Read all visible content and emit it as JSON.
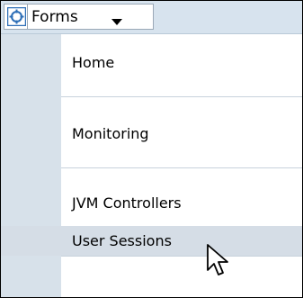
{
  "menu": {
    "title": "Forms",
    "icon": "forms-app-icon",
    "chevron": "chevron-down-icon",
    "items": [
      {
        "label": "Home"
      },
      {
        "label": "Monitoring"
      },
      {
        "label": "JVM Controllers"
      },
      {
        "label": "User Sessions",
        "state": "hovered"
      }
    ]
  },
  "colors": {
    "menubar": "#d7e3ee",
    "gutter": "#d7e1ea",
    "selected_row": "#d5dde6",
    "separator": "#c8d2dc",
    "icon_blue": "#2e6fb7"
  },
  "cursor": "arrow-pointer-icon"
}
